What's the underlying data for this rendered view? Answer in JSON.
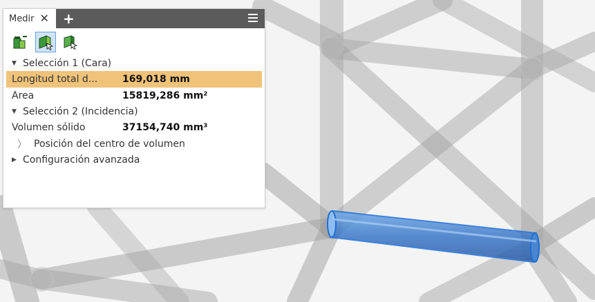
{
  "panel": {
    "tab_label": "Medir",
    "close_glyph": "✕",
    "add_glyph": "+",
    "toolbar": [
      {
        "icon": "measure-distance-icon",
        "active": false
      },
      {
        "icon": "select-face-icon",
        "active": true
      },
      {
        "icon": "select-body-icon",
        "active": false
      }
    ],
    "selection1": {
      "title": "Selección 1 (Cara)",
      "rows": [
        {
          "label": "Longitud total d...",
          "value": "169,018 mm"
        },
        {
          "label": "Área",
          "value": "15819,286 mm²"
        }
      ]
    },
    "selection2": {
      "title": "Selección 2 (Incidencia)",
      "rows": [
        {
          "label": "Volumen sólido",
          "value": "37154,740 mm³"
        }
      ],
      "subitem": "Posición del centro de volumen"
    },
    "advanced": "Configuración avanzada"
  },
  "colors": {
    "tab_bar": "#5b5b5b",
    "highlight_row": "#f0c37a",
    "selected_part": "#4a90d9"
  }
}
